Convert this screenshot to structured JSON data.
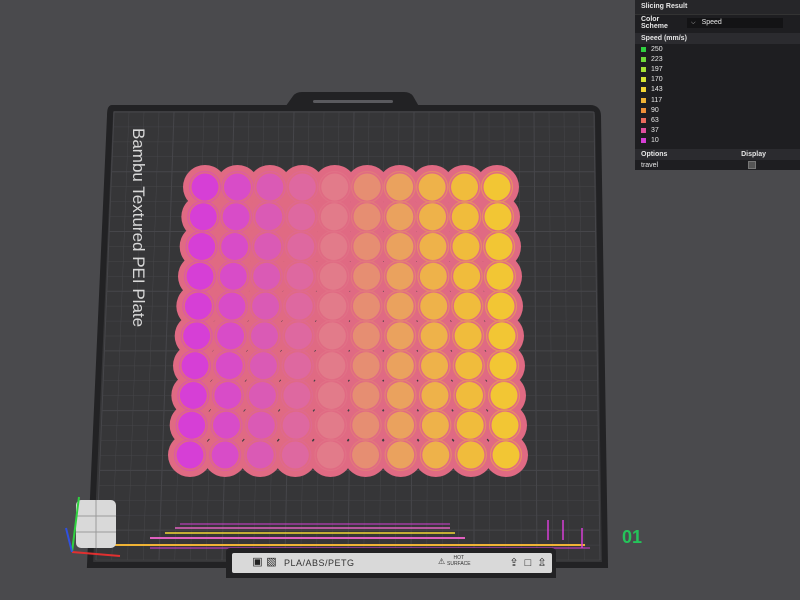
{
  "plate": {
    "name": "Bambu Textured PEI Plate"
  },
  "grid": {
    "rows": 10,
    "cols": 10
  },
  "panel": {
    "title": "Slicing Result",
    "color_scheme_label": "Color Scheme",
    "color_scheme_value": "Speed",
    "legend_title": "Speed (mm/s)",
    "legend": [
      {
        "value": "250",
        "color": "#2fd13f"
      },
      {
        "value": "223",
        "color": "#6fdc3a"
      },
      {
        "value": "197",
        "color": "#a5e336"
      },
      {
        "value": "170",
        "color": "#d6e634"
      },
      {
        "value": "143",
        "color": "#f2d634"
      },
      {
        "value": "117",
        "color": "#f0b335"
      },
      {
        "value": "90",
        "color": "#ee9038"
      },
      {
        "value": "63",
        "color": "#ea6c5d"
      },
      {
        "value": "37",
        "color": "#e04fa0"
      },
      {
        "value": "10",
        "color": "#d63fd6"
      }
    ],
    "options_label": "Options",
    "display_label": "Display",
    "options": [
      {
        "label": "travel"
      }
    ]
  },
  "toolbar": {
    "material": "PLA/ABS/PETG",
    "surface_line1": "HOT",
    "surface_line2": "SURFACE",
    "warning_icon": "warning-icon"
  },
  "layer": {
    "current": "01"
  },
  "colors": {
    "background": "#4a4a4d",
    "plate": "#363638",
    "plate_edge": "#222224",
    "grid_line": "#46464a",
    "brim": "#e06a83",
    "accent_green": "#24c45a"
  }
}
